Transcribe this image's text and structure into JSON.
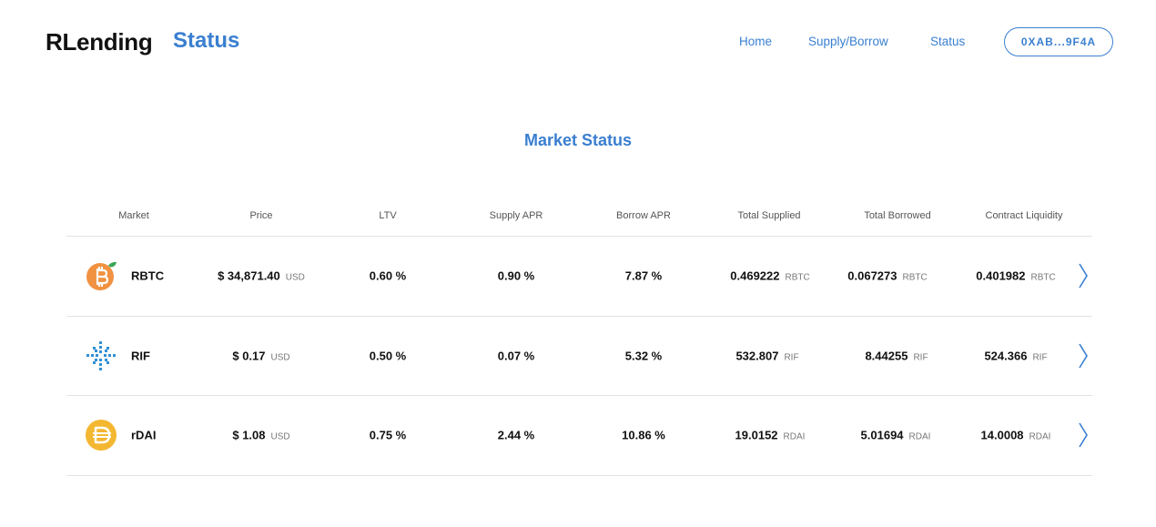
{
  "header": {
    "brand": "RLending",
    "page_name": "Status",
    "nav": [
      "Home",
      "Supply/Borrow",
      "Status"
    ],
    "wallet": "0XAB...9F4A"
  },
  "main": {
    "title": "Market Status",
    "columns": [
      "Market",
      "Price",
      "LTV",
      "Supply APR",
      "Borrow APR",
      "Total Supplied",
      "Total Borrowed",
      "Contract Liquidity"
    ],
    "rows": [
      {
        "icon": "rbtc-coin-icon",
        "market": "RBTC",
        "price": "$ 34,871.40",
        "price_unit": "USD",
        "ltv": "0.60 %",
        "supply_apr": "0.90 %",
        "borrow_apr": "7.87 %",
        "total_supplied": "0.469222",
        "total_borrowed": "0.067273",
        "liquidity": "0.401982",
        "unit": "RBTC"
      },
      {
        "icon": "rif-coin-icon",
        "market": "RIF",
        "price": "$ 0.17",
        "price_unit": "USD",
        "ltv": "0.50 %",
        "supply_apr": "0.07 %",
        "borrow_apr": "5.32 %",
        "total_supplied": "532.807",
        "total_borrowed": "8.44255",
        "liquidity": "524.366",
        "unit": "RIF"
      },
      {
        "icon": "rdai-coin-icon",
        "market": "rDAI",
        "price": "$ 1.08",
        "price_unit": "USD",
        "ltv": "0.75 %",
        "supply_apr": "2.44 %",
        "borrow_apr": "10.86 %",
        "total_supplied": "19.0152",
        "total_borrowed": "5.01694",
        "liquidity": "14.0008",
        "unit": "RDAI"
      }
    ]
  },
  "colors": {
    "accent": "#3a7fd0",
    "rbtc": "#f09242",
    "rdai": "#f4b731",
    "rif": "#2f8fd6"
  }
}
